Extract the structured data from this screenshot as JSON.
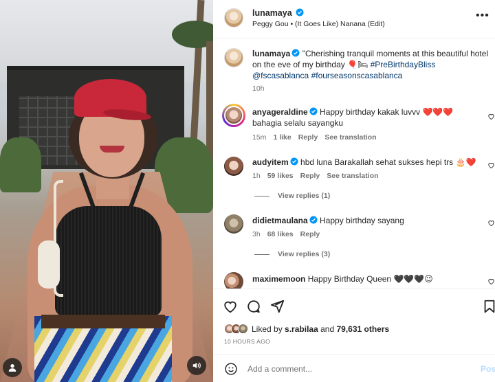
{
  "header": {
    "username": "lunamaya",
    "audio": "Peggy Gou • (It Goes Like) Nanana (Edit)",
    "more": "•••"
  },
  "caption": {
    "username": "lunamaya",
    "text": "\"Cherishing tranquil moments at this beautiful hotel on the eve of my birthday 🎈🛏",
    "hashtag1": "#PreBirthdayBliss",
    "mention": "@fscasablanca",
    "hashtag2": "#fourseasonscasablanca",
    "time": "10h"
  },
  "comments": [
    {
      "username": "anyageraldine",
      "text": "Happy birthday kakak luvvv ❤️❤️❤️ bahagia selalu sayangku",
      "time": "15m",
      "likes": "1 like",
      "reply": "Reply",
      "translate": "See translation"
    },
    {
      "username": "audyitem",
      "text": "hbd luna Barakallah sehat sukses hepi trs 🎂❤️",
      "time": "1h",
      "likes": "59 likes",
      "reply": "Reply",
      "translate": "See translation",
      "view_replies": "View replies (1)"
    },
    {
      "username": "didietmaulana",
      "text": "Happy birthday sayang",
      "time": "3h",
      "likes": "68 likes",
      "reply": "Reply",
      "view_replies": "View replies (3)"
    },
    {
      "username": "maximemoon",
      "text": "Happy Birthday Queen 🖤🖤🖤😉"
    }
  ],
  "likes": {
    "prefix": "Liked by",
    "user": "s.rabilaa",
    "and": "and",
    "count": "79,631 others"
  },
  "post_date": "10 HOURS AGO",
  "add_comment": {
    "placeholder": "Add a comment...",
    "post_label": "Post"
  },
  "colors": {
    "verified": "#0095f6",
    "link": "#00376b",
    "secondary_text": "#737373",
    "heart_red": "#ed4956"
  },
  "icons": {
    "like": "heart-outline-icon",
    "comment": "speech-bubble-icon",
    "share": "paper-plane-icon",
    "save": "bookmark-icon",
    "emoji": "smiley-icon",
    "user_tags": "person-icon",
    "sound": "speaker-icon"
  }
}
